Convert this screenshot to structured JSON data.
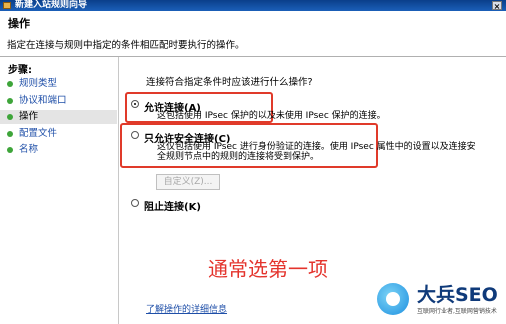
{
  "window": {
    "title": "新建入站规则向导",
    "close_label": "×"
  },
  "header": {
    "title": "操作",
    "subtitle": "指定在连接与规则中指定的条件相匹配时要执行的操作。"
  },
  "steps": {
    "heading": "步骤:",
    "items": [
      {
        "label": "规则类型",
        "active": false
      },
      {
        "label": "协议和端口",
        "active": false
      },
      {
        "label": "操作",
        "active": true
      },
      {
        "label": "配置文件",
        "active": false
      },
      {
        "label": "名称",
        "active": false
      }
    ]
  },
  "main": {
    "question": "连接符合指定条件时应该进行什么操作?",
    "options": [
      {
        "label": "允许连接(A)",
        "checked": true,
        "desc": [
          "这包括使用 IPsec 保护的以及未使用 IPsec 保护的连接。"
        ]
      },
      {
        "label": "只允许安全连接(C)",
        "checked": false,
        "desc": [
          "这仅包括使用 IPsec 进行身份验证的连接。使用 IPsec 属性中的设置以及连接安",
          "全规则节点中的规则的连接将受到保护。"
        ]
      },
      {
        "label": "阻止连接(K)",
        "checked": false,
        "desc": []
      }
    ],
    "custom_button": "自定义(Z)...",
    "help_link": "了解操作的详细信息"
  },
  "annotation": {
    "text": "通常选第一项",
    "color": "#e4342d"
  },
  "watermark": {
    "brand": "大兵SEO",
    "tagline": "互联网行业者,互联网营销技术"
  }
}
